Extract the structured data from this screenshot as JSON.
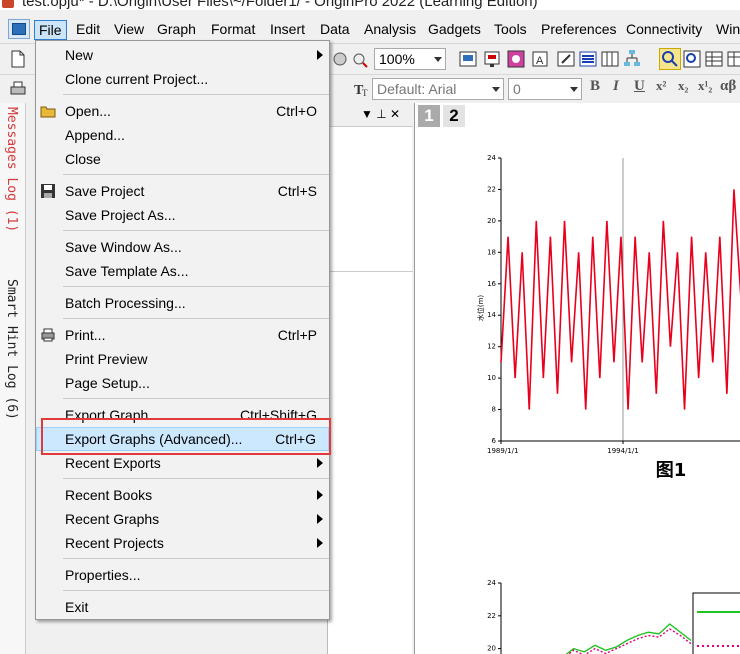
{
  "window": {
    "title": "test.opju* - D:\\Origin\\User Files\\~/Folder1/ - OriginPro 2022 (Learning Edition)"
  },
  "menubar": {
    "items": [
      "File",
      "Edit",
      "View",
      "Graph",
      "Format",
      "Insert",
      "Data",
      "Analysis",
      "Gadgets",
      "Tools",
      "Preferences",
      "Connectivity",
      "Win"
    ]
  },
  "toolbar": {
    "zoom": "100%",
    "font_label": "Default: Arial",
    "font_size": "0",
    "format_buttons": [
      "B",
      "I",
      "U",
      "x²",
      "x₂",
      "x¹₂",
      "αβ"
    ]
  },
  "side_tabs": {
    "messages": "Messages Log (1)",
    "smart_hint": "Smart Hint Log (6)"
  },
  "panel": {
    "pin": "▼ ⊥ ✕"
  },
  "graph": {
    "page_tabs": [
      "1",
      "2"
    ],
    "figure1_caption": "图1",
    "figure1_ylabel": "水位(m)",
    "colors": {
      "series1": "#e8001c",
      "series2_green": "#22c322",
      "series2_pink": "#e0007a"
    }
  },
  "chart_data": [
    {
      "type": "line",
      "title": "图1",
      "ylabel": "水位(m)",
      "xlabel": "",
      "x_ticks": [
        "1989/1/1",
        "1994/1/1"
      ],
      "ylim": [
        6,
        24
      ],
      "y_ticks": [
        6,
        8,
        10,
        12,
        14,
        16,
        18,
        20,
        22,
        24
      ],
      "series": [
        {
          "values": [
            11,
            19,
            10,
            18,
            8,
            20,
            10,
            19,
            9,
            20,
            11,
            18,
            8,
            19,
            10,
            20,
            11,
            19,
            8,
            19,
            11,
            18,
            9,
            20,
            12,
            18,
            8,
            19,
            10,
            18,
            11,
            19,
            9,
            22,
            15
          ]
        }
      ]
    },
    {
      "type": "line",
      "title": "",
      "ylim": [
        19,
        24
      ],
      "y_ticks": [
        20,
        22,
        24
      ],
      "series": [
        {
          "values": [
            19.5,
            20,
            19.8,
            20.2,
            19.9,
            20.1,
            20.5,
            20.8,
            21,
            20.9,
            21.5,
            21,
            20.5
          ]
        },
        {
          "values": [
            19.4,
            19.9,
            19.6,
            20.0,
            19.7,
            20.0,
            20.3,
            20.6,
            20.8,
            20.7,
            21.2,
            20.8,
            20.3
          ]
        }
      ]
    }
  ],
  "file_menu": {
    "items": [
      {
        "label": "New",
        "shortcut": "",
        "submenu": true
      },
      {
        "label": "Clone current Project...",
        "shortcut": ""
      },
      {
        "label": "Open...",
        "shortcut": "Ctrl+O"
      },
      {
        "label": "Append...",
        "shortcut": ""
      },
      {
        "label": "Close",
        "shortcut": ""
      },
      {
        "label": "Save Project",
        "shortcut": "Ctrl+S"
      },
      {
        "label": "Save Project As...",
        "shortcut": ""
      },
      {
        "label": "Save Window As...",
        "shortcut": ""
      },
      {
        "label": "Save Template As...",
        "shortcut": ""
      },
      {
        "label": "Batch Processing...",
        "shortcut": ""
      },
      {
        "label": "Print...",
        "shortcut": "Ctrl+P"
      },
      {
        "label": "Print Preview",
        "shortcut": ""
      },
      {
        "label": "Page Setup...",
        "shortcut": ""
      },
      {
        "label": "Export Graph",
        "shortcut": "Ctrl+Shift+G"
      },
      {
        "label": "Export Graphs (Advanced)...",
        "shortcut": "Ctrl+G"
      },
      {
        "label": "Recent Exports",
        "shortcut": "",
        "submenu": true
      },
      {
        "label": "Recent Books",
        "shortcut": "",
        "submenu": true
      },
      {
        "label": "Recent Graphs",
        "shortcut": "",
        "submenu": true
      },
      {
        "label": "Recent Projects",
        "shortcut": "",
        "submenu": true
      },
      {
        "label": "Properties...",
        "shortcut": ""
      },
      {
        "label": "Exit",
        "shortcut": ""
      }
    ]
  }
}
